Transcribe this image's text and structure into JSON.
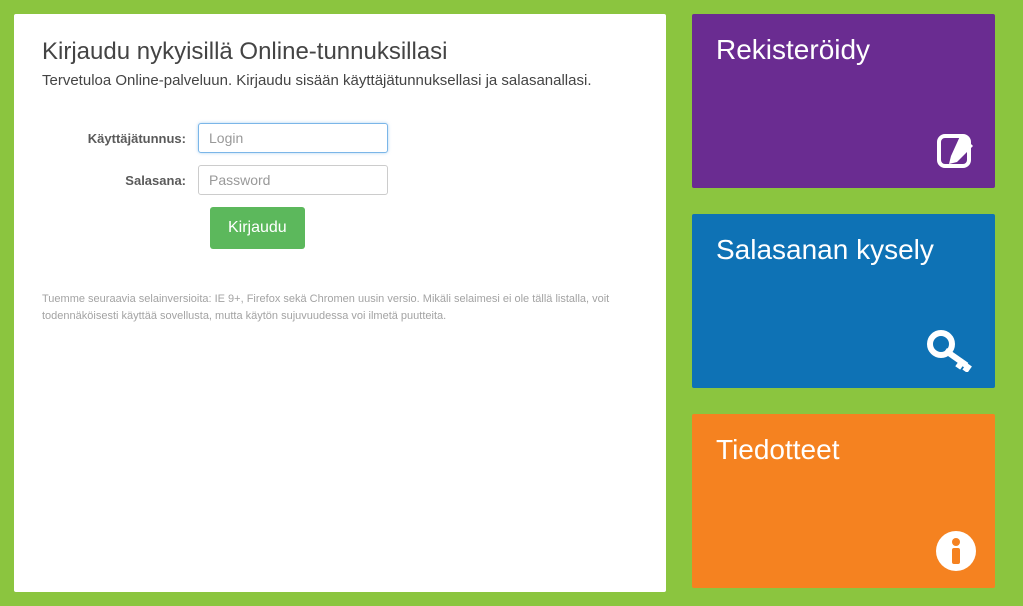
{
  "login": {
    "title": "Kirjaudu nykyisillä Online-tunnuksillasi",
    "subtitle": "Tervetuloa Online-palveluun. Kirjaudu sisään käyttäjätunnuksellasi ja salasanallasi.",
    "username_label": "Käyttäjätunnus:",
    "username_placeholder": "Login",
    "password_label": "Salasana:",
    "password_placeholder": "Password",
    "button": "Kirjaudu",
    "browser_note": "Tuemme seuraavia selainversioita: IE 9+, Firefox sekä Chromen uusin versio. Mikäli selaimesi ei ole tällä listalla, voit todennäköisesti käyttää sovellusta, mutta käytön sujuvuudessa voi ilmetä puutteita."
  },
  "tiles": {
    "register": "Rekisteröidy",
    "password_query": "Salasanan kysely",
    "bulletins": "Tiedotteet"
  },
  "colors": {
    "page_bg": "#8bc53f",
    "purple": "#6a2c91",
    "blue": "#0e72b5",
    "orange": "#f58220",
    "button_green": "#5cb85c"
  }
}
